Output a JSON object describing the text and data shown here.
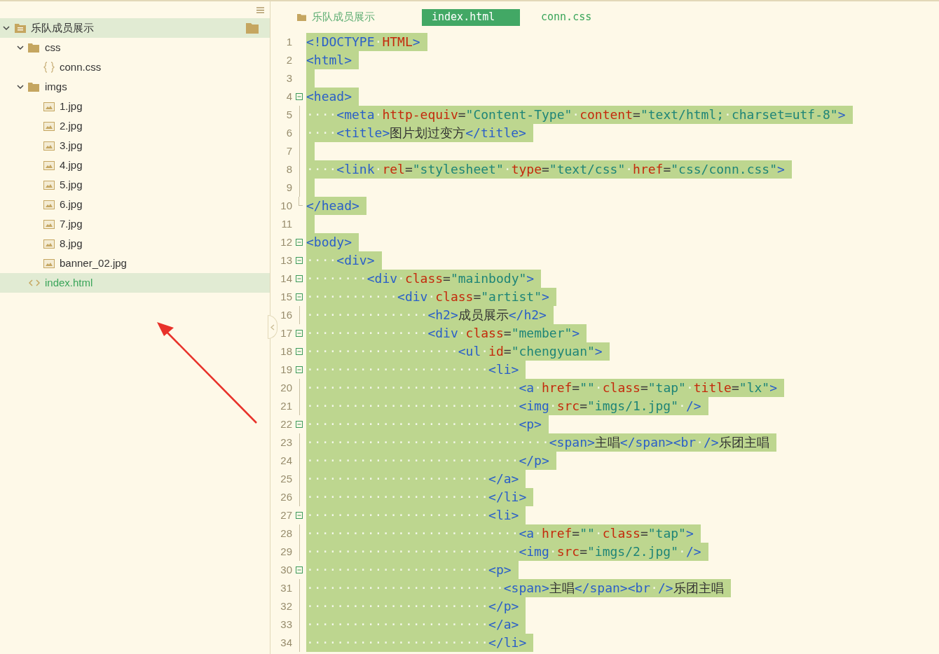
{
  "sidebar": {
    "tree": [
      {
        "kind": "project",
        "label": "乐队成员展示",
        "expanded": true,
        "selected": true,
        "children": [
          {
            "kind": "folder",
            "label": "css",
            "expanded": true,
            "selected": false,
            "children": [
              {
                "kind": "css",
                "label": "conn.css",
                "selected": false
              }
            ]
          },
          {
            "kind": "folder",
            "label": "imgs",
            "expanded": true,
            "selected": false,
            "children": [
              {
                "kind": "image",
                "label": "1.jpg",
                "selected": false
              },
              {
                "kind": "image",
                "label": "2.jpg",
                "selected": false
              },
              {
                "kind": "image",
                "label": "3.jpg",
                "selected": false
              },
              {
                "kind": "image",
                "label": "4.jpg",
                "selected": false
              },
              {
                "kind": "image",
                "label": "5.jpg",
                "selected": false
              },
              {
                "kind": "image",
                "label": "6.jpg",
                "selected": false
              },
              {
                "kind": "image",
                "label": "7.jpg",
                "selected": false
              },
              {
                "kind": "image",
                "label": "8.jpg",
                "selected": false
              },
              {
                "kind": "image",
                "label": "banner_02.jpg",
                "selected": false
              }
            ]
          },
          {
            "kind": "html",
            "label": "index.html",
            "selected": true
          }
        ]
      }
    ]
  },
  "editor": {
    "project_label": "乐队成员展示",
    "tabs": [
      {
        "label": "index.html",
        "selected": true
      },
      {
        "label": "conn.css",
        "selected": false
      }
    ],
    "lines": [
      {
        "number": "1",
        "selected": true,
        "tokens": [
          {
            "kind": "tag",
            "text": "<!DOCTYPE"
          },
          {
            "kind": "ws",
            "text": "·"
          },
          {
            "kind": "attr",
            "text": "HTML"
          },
          {
            "kind": "tag",
            "text": ">"
          }
        ]
      },
      {
        "number": "2",
        "selected": true,
        "tokens": [
          {
            "kind": "tag",
            "text": "<html>"
          }
        ]
      },
      {
        "number": "3",
        "selected": true
      },
      {
        "number": "4",
        "selected": true,
        "collapsible": true,
        "tokens": [
          {
            "kind": "tag",
            "text": "<head>"
          }
        ]
      },
      {
        "number": "5",
        "selected": true,
        "in_block": true,
        "tokens": [
          {
            "kind": "ws",
            "text": "····"
          },
          {
            "kind": "tag",
            "text": "<meta"
          },
          {
            "kind": "ws",
            "text": "·"
          },
          {
            "kind": "attr",
            "text": "http-equiv"
          },
          {
            "kind": "punct",
            "text": "="
          },
          {
            "kind": "str",
            "text": "\"Content-Type\""
          },
          {
            "kind": "ws",
            "text": "·"
          },
          {
            "kind": "attr",
            "text": "content"
          },
          {
            "kind": "punct",
            "text": "="
          },
          {
            "kind": "str",
            "text": "\"text/html;"
          },
          {
            "kind": "ws",
            "text": "·"
          },
          {
            "kind": "str",
            "text": "charset=utf-8\""
          },
          {
            "kind": "tag",
            "text": ">"
          }
        ]
      },
      {
        "number": "6",
        "selected": true,
        "in_block": true,
        "tokens": [
          {
            "kind": "ws",
            "text": "····"
          },
          {
            "kind": "tag",
            "text": "<title>"
          },
          {
            "kind": "text",
            "text": "图片划过变方"
          },
          {
            "kind": "tag",
            "text": "</title>"
          }
        ]
      },
      {
        "number": "7",
        "selected": true,
        "in_block": true
      },
      {
        "number": "8",
        "selected": true,
        "in_block": true,
        "tokens": [
          {
            "kind": "ws",
            "text": "····"
          },
          {
            "kind": "tag",
            "text": "<link"
          },
          {
            "kind": "ws",
            "text": "·"
          },
          {
            "kind": "attr",
            "text": "rel"
          },
          {
            "kind": "punct",
            "text": "="
          },
          {
            "kind": "str",
            "text": "\"stylesheet\""
          },
          {
            "kind": "ws",
            "text": "·"
          },
          {
            "kind": "attr",
            "text": "type"
          },
          {
            "kind": "punct",
            "text": "="
          },
          {
            "kind": "str",
            "text": "\"text/css\""
          },
          {
            "kind": "ws",
            "text": "·"
          },
          {
            "kind": "attr",
            "text": "href"
          },
          {
            "kind": "punct",
            "text": "="
          },
          {
            "kind": "str",
            "text": "\"css/conn.css\""
          },
          {
            "kind": "tag",
            "text": ">"
          }
        ]
      },
      {
        "number": "9",
        "selected": true,
        "in_block": true
      },
      {
        "number": "10",
        "selected": true,
        "block_end": true,
        "tokens": [
          {
            "kind": "tag",
            "text": "</head>"
          }
        ]
      },
      {
        "number": "11",
        "selected": true
      },
      {
        "number": "12",
        "selected": true,
        "collapsible": true,
        "tokens": [
          {
            "kind": "tag",
            "text": "<body>"
          }
        ]
      },
      {
        "number": "13",
        "selected": true,
        "collapsible": true,
        "tokens": [
          {
            "kind": "ws",
            "text": "····"
          },
          {
            "kind": "tag",
            "text": "<div>"
          }
        ]
      },
      {
        "number": "14",
        "selected": true,
        "collapsible": true,
        "tokens": [
          {
            "kind": "ws",
            "text": "········"
          },
          {
            "kind": "tag",
            "text": "<div"
          },
          {
            "kind": "ws",
            "text": "·"
          },
          {
            "kind": "attr",
            "text": "class"
          },
          {
            "kind": "punct",
            "text": "="
          },
          {
            "kind": "str",
            "text": "\"mainbody\""
          },
          {
            "kind": "tag",
            "text": ">"
          }
        ]
      },
      {
        "number": "15",
        "selected": true,
        "collapsible": true,
        "tokens": [
          {
            "kind": "ws",
            "text": "············"
          },
          {
            "kind": "tag",
            "text": "<div"
          },
          {
            "kind": "ws",
            "text": "·"
          },
          {
            "kind": "attr",
            "text": "class"
          },
          {
            "kind": "punct",
            "text": "="
          },
          {
            "kind": "str",
            "text": "\"artist\""
          },
          {
            "kind": "tag",
            "text": ">"
          }
        ]
      },
      {
        "number": "16",
        "selected": true,
        "in_block": true,
        "tokens": [
          {
            "kind": "ws",
            "text": "················"
          },
          {
            "kind": "tag",
            "text": "<h2>"
          },
          {
            "kind": "text",
            "text": "成员展示"
          },
          {
            "kind": "tag",
            "text": "</h2>"
          }
        ]
      },
      {
        "number": "17",
        "selected": true,
        "collapsible": true,
        "tokens": [
          {
            "kind": "ws",
            "text": "················"
          },
          {
            "kind": "tag",
            "text": "<div"
          },
          {
            "kind": "ws",
            "text": "·"
          },
          {
            "kind": "attr",
            "text": "class"
          },
          {
            "kind": "punct",
            "text": "="
          },
          {
            "kind": "str",
            "text": "\"member\""
          },
          {
            "kind": "tag",
            "text": ">"
          }
        ]
      },
      {
        "number": "18",
        "selected": true,
        "collapsible": true,
        "tokens": [
          {
            "kind": "ws",
            "text": "····················"
          },
          {
            "kind": "tag",
            "text": "<ul"
          },
          {
            "kind": "ws",
            "text": "·"
          },
          {
            "kind": "attr",
            "text": "id"
          },
          {
            "kind": "punct",
            "text": "="
          },
          {
            "kind": "str",
            "text": "\"chengyuan\""
          },
          {
            "kind": "tag",
            "text": ">"
          }
        ]
      },
      {
        "number": "19",
        "selected": true,
        "collapsible": true,
        "tokens": [
          {
            "kind": "ws",
            "text": "························"
          },
          {
            "kind": "tag",
            "text": "<li>"
          }
        ]
      },
      {
        "number": "20",
        "selected": true,
        "in_block": true,
        "tokens": [
          {
            "kind": "ws",
            "text": "····························"
          },
          {
            "kind": "tag",
            "text": "<a"
          },
          {
            "kind": "ws",
            "text": "·"
          },
          {
            "kind": "attr",
            "text": "href"
          },
          {
            "kind": "punct",
            "text": "="
          },
          {
            "kind": "str",
            "text": "\"\""
          },
          {
            "kind": "ws",
            "text": "·"
          },
          {
            "kind": "attr",
            "text": "class"
          },
          {
            "kind": "punct",
            "text": "="
          },
          {
            "kind": "str",
            "text": "\"tap\""
          },
          {
            "kind": "ws",
            "text": "·"
          },
          {
            "kind": "attr",
            "text": "title"
          },
          {
            "kind": "punct",
            "text": "="
          },
          {
            "kind": "str",
            "text": "\"lx\""
          },
          {
            "kind": "tag",
            "text": ">"
          }
        ]
      },
      {
        "number": "21",
        "selected": true,
        "in_block": true,
        "tokens": [
          {
            "kind": "ws",
            "text": "····························"
          },
          {
            "kind": "tag",
            "text": "<img"
          },
          {
            "kind": "ws",
            "text": "·"
          },
          {
            "kind": "attr",
            "text": "src"
          },
          {
            "kind": "punct",
            "text": "="
          },
          {
            "kind": "str",
            "text": "\"imgs/1.jpg\""
          },
          {
            "kind": "ws",
            "text": "·"
          },
          {
            "kind": "tag",
            "text": "/>"
          }
        ]
      },
      {
        "number": "22",
        "selected": true,
        "collapsible": true,
        "tokens": [
          {
            "kind": "ws",
            "text": "····························"
          },
          {
            "kind": "tag",
            "text": "<p>"
          }
        ]
      },
      {
        "number": "23",
        "selected": true,
        "in_block": true,
        "tokens": [
          {
            "kind": "ws",
            "text": "································"
          },
          {
            "kind": "tag",
            "text": "<span>"
          },
          {
            "kind": "text",
            "text": "主唱"
          },
          {
            "kind": "tag",
            "text": "</span><br"
          },
          {
            "kind": "ws",
            "text": "·"
          },
          {
            "kind": "tag",
            "text": "/>"
          },
          {
            "kind": "text",
            "text": "乐团主唱"
          }
        ]
      },
      {
        "number": "24",
        "selected": true,
        "in_block": true,
        "tokens": [
          {
            "kind": "ws",
            "text": "····························"
          },
          {
            "kind": "tag",
            "text": "</p>"
          }
        ]
      },
      {
        "number": "25",
        "selected": true,
        "in_block": true,
        "tokens": [
          {
            "kind": "ws",
            "text": "························"
          },
          {
            "kind": "tag",
            "text": "</a>"
          }
        ]
      },
      {
        "number": "26",
        "selected": true,
        "in_block": true,
        "tokens": [
          {
            "kind": "ws",
            "text": "························"
          },
          {
            "kind": "tag",
            "text": "</li>"
          }
        ]
      },
      {
        "number": "27",
        "selected": true,
        "collapsible": true,
        "tokens": [
          {
            "kind": "ws",
            "text": "························"
          },
          {
            "kind": "tag",
            "text": "<li>"
          }
        ]
      },
      {
        "number": "28",
        "selected": true,
        "in_block": true,
        "tokens": [
          {
            "kind": "ws",
            "text": "····························"
          },
          {
            "kind": "tag",
            "text": "<a"
          },
          {
            "kind": "ws",
            "text": "·"
          },
          {
            "kind": "attr",
            "text": "href"
          },
          {
            "kind": "punct",
            "text": "="
          },
          {
            "kind": "str",
            "text": "\"\""
          },
          {
            "kind": "ws",
            "text": "·"
          },
          {
            "kind": "attr",
            "text": "class"
          },
          {
            "kind": "punct",
            "text": "="
          },
          {
            "kind": "str",
            "text": "\"tap\""
          },
          {
            "kind": "tag",
            "text": ">"
          }
        ]
      },
      {
        "number": "29",
        "selected": true,
        "in_block": true,
        "tokens": [
          {
            "kind": "ws",
            "text": "····························"
          },
          {
            "kind": "tag",
            "text": "<img"
          },
          {
            "kind": "ws",
            "text": "·"
          },
          {
            "kind": "attr",
            "text": "src"
          },
          {
            "kind": "punct",
            "text": "="
          },
          {
            "kind": "str",
            "text": "\"imgs/2.jpg\""
          },
          {
            "kind": "ws",
            "text": "·"
          },
          {
            "kind": "tag",
            "text": "/>"
          }
        ]
      },
      {
        "number": "30",
        "selected": true,
        "collapsible": true,
        "tokens": [
          {
            "kind": "ws",
            "text": "························"
          },
          {
            "kind": "tag",
            "text": "<p>"
          }
        ]
      },
      {
        "number": "31",
        "selected": true,
        "in_block": true,
        "tokens": [
          {
            "kind": "ws",
            "text": "··························"
          },
          {
            "kind": "tag",
            "text": "<span>"
          },
          {
            "kind": "text",
            "text": "主唱"
          },
          {
            "kind": "tag",
            "text": "</span><br"
          },
          {
            "kind": "ws",
            "text": "·"
          },
          {
            "kind": "tag",
            "text": "/>"
          },
          {
            "kind": "text",
            "text": "乐团主唱"
          }
        ]
      },
      {
        "number": "32",
        "selected": true,
        "in_block": true,
        "tokens": [
          {
            "kind": "ws",
            "text": "························"
          },
          {
            "kind": "tag",
            "text": "</p>"
          }
        ]
      },
      {
        "number": "33",
        "selected": true,
        "in_block": true,
        "tokens": [
          {
            "kind": "ws",
            "text": "························"
          },
          {
            "kind": "tag",
            "text": "</a>"
          }
        ]
      },
      {
        "number": "34",
        "selected": true,
        "in_block": true,
        "tokens": [
          {
            "kind": "ws",
            "text": "························"
          },
          {
            "kind": "tag",
            "text": "</li>"
          }
        ]
      }
    ]
  }
}
